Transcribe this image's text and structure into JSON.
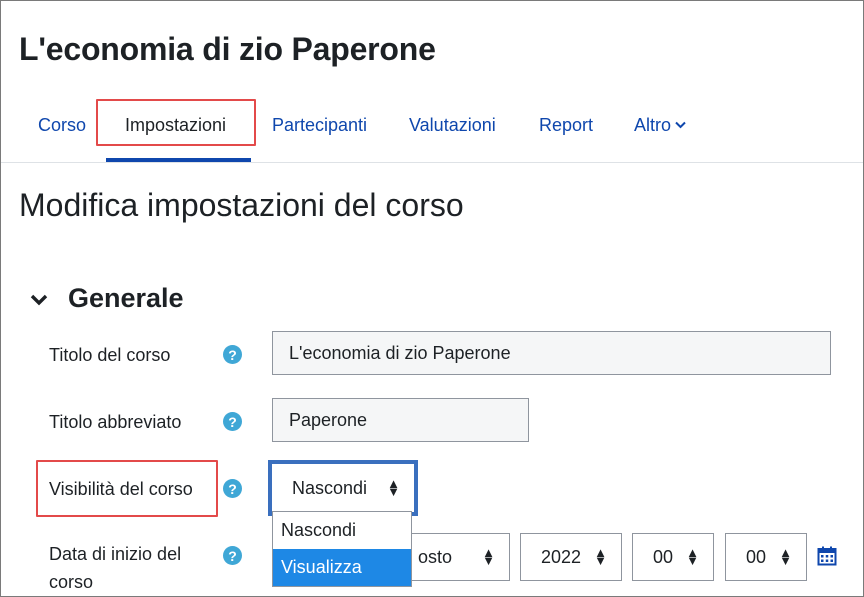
{
  "course": {
    "title": "L'economia di zio Paperone"
  },
  "tabs": [
    {
      "label": "Corso"
    },
    {
      "label": "Impostazioni"
    },
    {
      "label": "Partecipanti"
    },
    {
      "label": "Valutazioni"
    },
    {
      "label": "Report"
    },
    {
      "label": "Altro"
    }
  ],
  "page": {
    "heading": "Modifica impostazioni del corso"
  },
  "section": {
    "title": "Generale"
  },
  "fields": {
    "fullname": {
      "label": "Titolo del corso",
      "value": "L'economia di zio Paperone"
    },
    "shortname": {
      "label": "Titolo abbreviato",
      "value": "Paperone"
    },
    "visibility": {
      "label": "Visibilità del corso",
      "value": "Nascondi",
      "options": [
        "Nascondi",
        "Visualizza"
      ],
      "highlighted_option": "Visualizza"
    },
    "startdate": {
      "label_line1": "Data di inizio del",
      "label_line2": "corso",
      "month_partial": "osto",
      "year": "2022",
      "hour": "00",
      "minute": "00"
    }
  },
  "colors": {
    "link": "#0f47ad",
    "help_icon": "#3fa7d6",
    "highlight": "#e34a4a",
    "focus": "#3a6fbe",
    "option_selected": "#1e88e5"
  },
  "icons": {
    "help": "question-circle-icon",
    "section_toggle": "chevron-down-icon",
    "calendar": "calendar-icon"
  }
}
